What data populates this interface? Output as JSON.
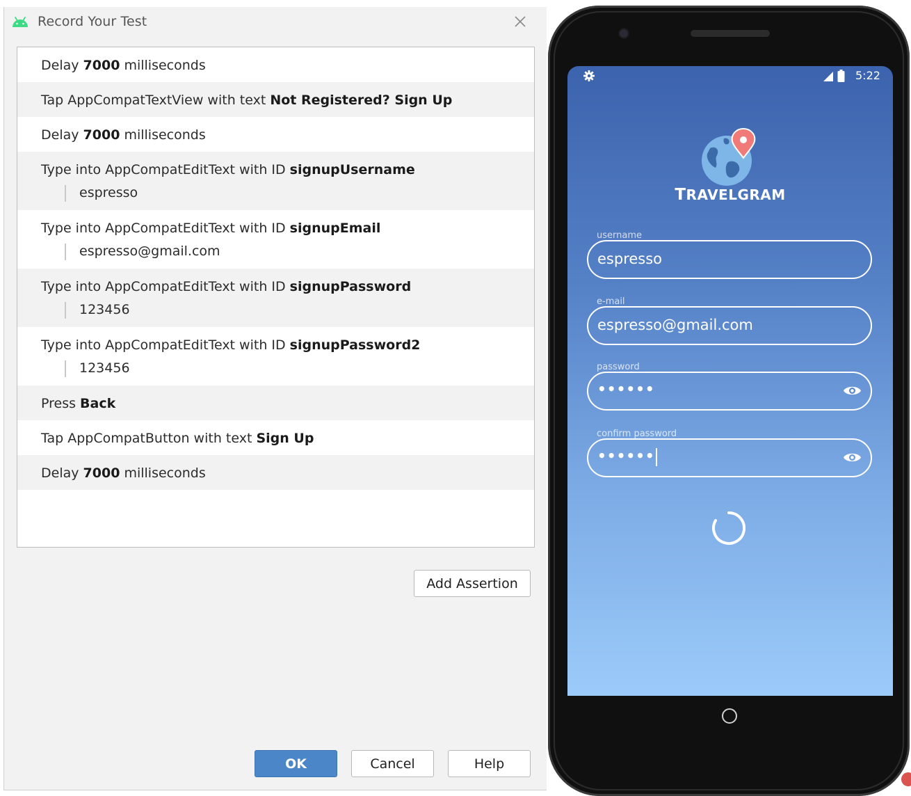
{
  "dialog": {
    "title": "Record Your Test",
    "steps": [
      {
        "prefix": "Delay ",
        "bold": "7000",
        "suffix": " milliseconds",
        "sub": null
      },
      {
        "prefix": "Tap AppCompatTextView with text ",
        "bold": "Not Registered? Sign Up",
        "suffix": "",
        "sub": null
      },
      {
        "prefix": "Delay ",
        "bold": "7000",
        "suffix": " milliseconds",
        "sub": null
      },
      {
        "prefix": "Type into AppCompatEditText with ID ",
        "bold": "signupUsername",
        "suffix": "",
        "sub": "espresso"
      },
      {
        "prefix": "Type into AppCompatEditText with ID ",
        "bold": "signupEmail",
        "suffix": "",
        "sub": "espresso@gmail.com"
      },
      {
        "prefix": "Type into AppCompatEditText with ID ",
        "bold": "signupPassword",
        "suffix": "",
        "sub": "123456"
      },
      {
        "prefix": "Type into AppCompatEditText with ID ",
        "bold": "signupPassword2",
        "suffix": "",
        "sub": "123456"
      },
      {
        "prefix": "Press ",
        "bold": "Back",
        "suffix": "",
        "sub": null
      },
      {
        "prefix": "Tap AppCompatButton with text ",
        "bold": "Sign Up",
        "suffix": "",
        "sub": null
      },
      {
        "prefix": "Delay ",
        "bold": "7000",
        "suffix": " milliseconds",
        "sub": null
      }
    ],
    "add_assertion_label": "Add Assertion",
    "ok_label": "OK",
    "cancel_label": "Cancel",
    "help_label": "Help"
  },
  "phone": {
    "time": "5:22",
    "brand_first": "T",
    "brand_rest": "RAVELGRAM",
    "fields": {
      "username_label": "username",
      "username_value": "espresso",
      "email_label": "e-mail",
      "email_value": "espresso@gmail.com",
      "password_label": "password",
      "password_value": "••••••",
      "confirm_label": "confirm password",
      "confirm_value": "••••••"
    }
  },
  "colors": {
    "primary_button": "#4a86c8",
    "android_green": "#3ddc84",
    "screen_top": "#3c63ad",
    "screen_bottom": "#9ccbfa"
  }
}
